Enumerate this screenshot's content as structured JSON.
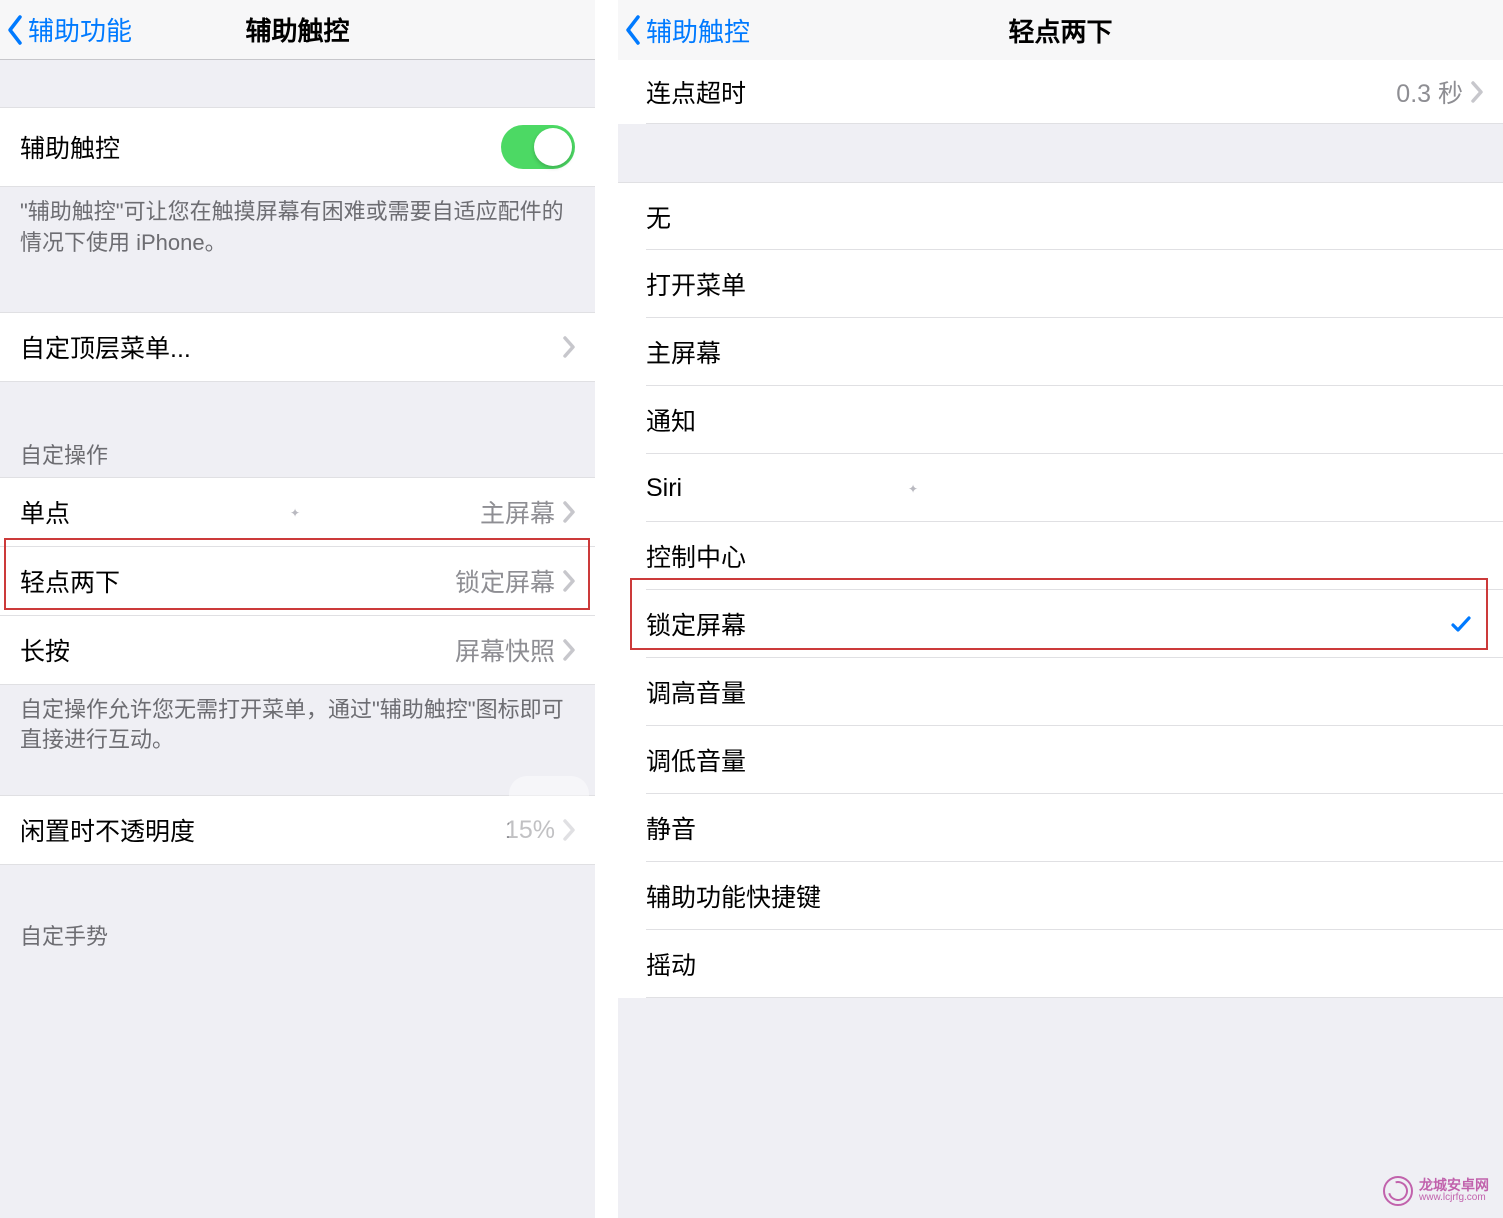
{
  "left": {
    "nav_back": "辅助功能",
    "nav_title": "辅助触控",
    "toggle_label": "辅助触控",
    "toggle_footer": "\"辅助触控\"可让您在触摸屏幕有困难或需要自适应配件的情况下使用 iPhone。",
    "top_menu": "自定顶层菜单...",
    "section_actions": "自定操作",
    "actions": [
      {
        "label": "单点",
        "value": "主屏幕"
      },
      {
        "label": "轻点两下",
        "value": "锁定屏幕"
      },
      {
        "label": "长按",
        "value": "屏幕快照"
      }
    ],
    "actions_footer": "自定操作允许您无需打开菜单，通过\"辅助触控\"图标即可直接进行互动。",
    "opacity_label": "闲置时不透明度",
    "opacity_value": "15%",
    "section_gestures": "自定手势"
  },
  "right": {
    "nav_back": "辅助触控",
    "nav_title": "轻点两下",
    "timeout_label": "连点超时",
    "timeout_value": "0.3 秒",
    "options": [
      {
        "label": "无",
        "checked": false
      },
      {
        "label": "打开菜单",
        "checked": false
      },
      {
        "label": "主屏幕",
        "checked": false
      },
      {
        "label": "通知",
        "checked": false
      },
      {
        "label": "Siri",
        "checked": false
      },
      {
        "label": "控制中心",
        "checked": false
      },
      {
        "label": "锁定屏幕",
        "checked": true
      },
      {
        "label": "调高音量",
        "checked": false
      },
      {
        "label": "调低音量",
        "checked": false
      },
      {
        "label": "静音",
        "checked": false
      },
      {
        "label": "辅助功能快捷键",
        "checked": false
      },
      {
        "label": "摇动",
        "checked": false
      }
    ]
  },
  "watermark": {
    "title": "龙城安卓网",
    "url": "www.lcjrfg.com"
  }
}
